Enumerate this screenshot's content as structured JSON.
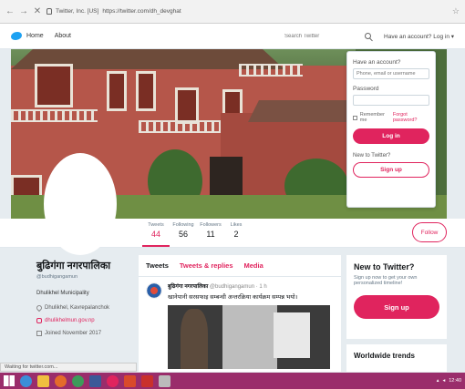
{
  "browser": {
    "back": "←",
    "forward": "→",
    "close": "✕",
    "url_site": "Twitter, Inc. [US]",
    "url": "https://twitter.com/dh_devghat"
  },
  "topbar": {
    "home": "Home",
    "about": "About",
    "search_placeholder": "Search Twitter",
    "language": "Have an account? Log in ▾"
  },
  "login": {
    "title": "Have an account?",
    "user_placeholder": "Phone, email or username",
    "password_label": "Password",
    "remember": "Remember me",
    "forgot": "Forgot password?",
    "login_button": "Log in",
    "new_to_twitter": "New to Twitter?",
    "signup_button": "Sign up"
  },
  "profile_nav": {
    "stats": [
      {
        "label": "Tweets",
        "value": "44"
      },
      {
        "label": "Following",
        "value": "56"
      },
      {
        "label": "Followers",
        "value": "11"
      },
      {
        "label": "Likes",
        "value": "2"
      }
    ],
    "follow_button": "Follow"
  },
  "profile": {
    "name": "बुढिगंगा नगरपालिका",
    "handle": "@budhigangamun",
    "bio": "Dhulikhel Municipality",
    "location": "Dhulikhel, Kavrepalanchok",
    "website": "dhulikhelmun.gov.np",
    "joined": "Joined November 2017"
  },
  "timeline": {
    "tabs": [
      "Tweets",
      "Tweets & replies",
      "Media"
    ],
    "tweet": {
      "author": "बुढिगंगा नगरपालिका",
      "meta": "@budhigangamun · 1 h",
      "text": "खानेपानी सरसफाइ सम्बन्धी अन्तरक्रिया कार्यक्रम सम्पन्न भयो।"
    }
  },
  "new_to_twitter": {
    "title": "New to Twitter?",
    "subtitle": "Sign up now to get your own personalized timeline!",
    "button": "Sign up"
  },
  "trends": {
    "title": "Worldwide trends"
  },
  "status_bar": "Waiting for twitter.com...",
  "taskbar": {
    "clock": "12:40"
  },
  "colors": {
    "accent": "#e0245e",
    "twitter_blue": "#1da1f2",
    "taskbar": "#9a2d6b"
  }
}
